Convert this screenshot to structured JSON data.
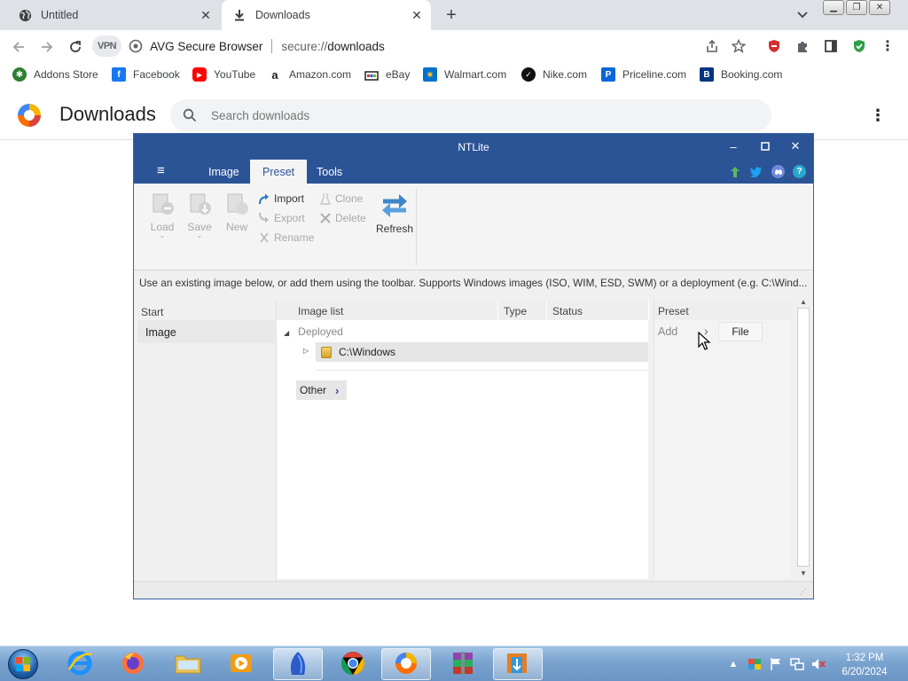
{
  "browser": {
    "tabs": [
      {
        "title": "Untitled",
        "icon": "globe-icon",
        "active": false
      },
      {
        "title": "Downloads",
        "icon": "download-icon",
        "active": true
      }
    ],
    "omnibox": {
      "vpn_label": "VPN",
      "brand": "AVG Secure Browser",
      "url_scheme": "secure://",
      "url_path": "downloads"
    },
    "bookmarks": [
      {
        "label": "Addons Store",
        "icon": "addons-store-icon",
        "color": "#2e7d32"
      },
      {
        "label": "Facebook",
        "icon": "facebook-icon",
        "color": "#1877f2"
      },
      {
        "label": "YouTube",
        "icon": "youtube-icon",
        "color": "#ff0000"
      },
      {
        "label": "Amazon.com",
        "icon": "amazon-icon",
        "color": "#222222"
      },
      {
        "label": "eBay",
        "icon": "ebay-icon",
        "color": "#e53238"
      },
      {
        "label": "Walmart.com",
        "icon": "walmart-icon",
        "color": "#0071ce"
      },
      {
        "label": "Nike.com",
        "icon": "nike-icon",
        "color": "#111111"
      },
      {
        "label": "Priceline.com",
        "icon": "priceline-icon",
        "color": "#0a66d8"
      },
      {
        "label": "Booking.com",
        "icon": "booking-icon",
        "color": "#003580"
      }
    ]
  },
  "downloads_page": {
    "title": "Downloads",
    "search_placeholder": "Search downloads"
  },
  "ntlite": {
    "window_title": "NTLite",
    "menu_tabs": [
      {
        "label": "Image",
        "active": false
      },
      {
        "label": "Preset",
        "active": true
      },
      {
        "label": "Tools",
        "active": false
      }
    ],
    "ribbon": {
      "big_buttons": [
        {
          "label": "Load",
          "enabled": false
        },
        {
          "label": "Save",
          "enabled": false
        },
        {
          "label": "New",
          "enabled": false
        }
      ],
      "import_label": "Import",
      "export_label": "Export",
      "rename_label": "Rename",
      "clone_label": "Clone",
      "delete_label": "Delete",
      "refresh_label": "Refresh"
    },
    "info_text": "Use an existing image below, or add them using the toolbar. Supports Windows images (ISO, WIM, ESD, SWM) or a deployment (e.g. C:\\Wind...",
    "left_panel": {
      "header": "Start",
      "item": "Image"
    },
    "image_list": {
      "columns": [
        "Image list",
        "Type",
        "Status"
      ],
      "group_label": "Deployed",
      "rows": [
        {
          "name": "C:\\Windows",
          "type": "",
          "status": ""
        }
      ],
      "other_label": "Other"
    },
    "preset_panel": {
      "header": "Preset",
      "add_label": "Add",
      "file_button": "File"
    }
  },
  "taskbar": {
    "apps": [
      {
        "name": "internet-explorer",
        "active": false
      },
      {
        "name": "firefox",
        "active": false
      },
      {
        "name": "file-explorer",
        "active": false
      },
      {
        "name": "media-player",
        "active": false
      },
      {
        "name": "ntlite-app",
        "active": true
      },
      {
        "name": "chrome",
        "active": false
      },
      {
        "name": "avg-browser",
        "active": true
      },
      {
        "name": "winrar",
        "active": false
      },
      {
        "name": "ntlite-installer",
        "active": true
      }
    ],
    "time": "1:32 PM",
    "date": "6/20/2024"
  },
  "colors": {
    "ntlite_blue": "#2b5496",
    "chrome_tabstrip": "#dee1e6"
  }
}
